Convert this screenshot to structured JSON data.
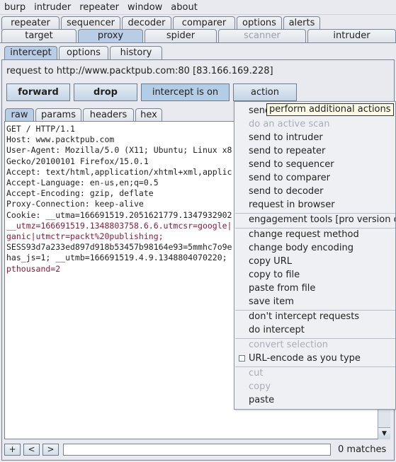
{
  "menubar": [
    "burp",
    "intruder",
    "repeater",
    "window",
    "about"
  ],
  "tabs_row1": [
    "repeater",
    "sequencer",
    "decoder",
    "comparer",
    "options",
    "alerts"
  ],
  "tabs_row2": [
    "target",
    "proxy",
    "spider",
    "scanner",
    "intruder"
  ],
  "subtabs": [
    "intercept",
    "options",
    "history"
  ],
  "request_line": "request to http://www.packtpub.com:80  [83.166.169.228]",
  "buttons": {
    "forward": "forward",
    "drop": "drop",
    "intercept": "intercept is on",
    "action": "action"
  },
  "viewtabs": [
    "raw",
    "params",
    "headers",
    "hex"
  ],
  "request_text": [
    "GET / HTTP/1.1",
    "Host: www.packtpub.com",
    "User-Agent: Mozilla/5.0 (X11; Ubuntu; Linux x8",
    "Gecko/20100101 Firefox/15.0.1",
    "Accept: text/html,application/xhtml+xml,applic",
    "Accept-Language: en-us,en;q=0.5",
    "Accept-Encoding: gzip, deflate",
    "Proxy-Connection: keep-alive",
    "Cookie: __utma=166691519.2051621779.1347932902",
    "__utmz=166691519.1348803758.6.6.utmcsr=google|",
    "ganic|utmctr=packt%20publishing;",
    "SESS93d7a233ed897d918b53457b98164e93=5mmhc7o9e",
    "has_js=1; __utmb=166691519.4.9.1348804070220;",
    "pthousand=2"
  ],
  "bottom": {
    "plus": "+",
    "prev": "<",
    "next": ">",
    "search_value": "",
    "matches": "0 matches"
  },
  "action_menu": {
    "group1": [
      "send to spider",
      "do an active scan",
      "send to intruder",
      "send to repeater",
      "send to sequencer",
      "send to comparer",
      "send to decoder",
      "request in browser"
    ],
    "group2": [
      "engagement tools [pro version only]"
    ],
    "group3": [
      "change request method",
      "change body encoding",
      "copy URL",
      "copy to file",
      "paste from file",
      "save item"
    ],
    "group4": [
      "don't intercept requests",
      "do intercept"
    ],
    "group5": [
      "convert selection",
      "URL-encode as you type"
    ],
    "group6": [
      "cut",
      "copy",
      "paste"
    ]
  },
  "tooltip": "perform additional actions"
}
